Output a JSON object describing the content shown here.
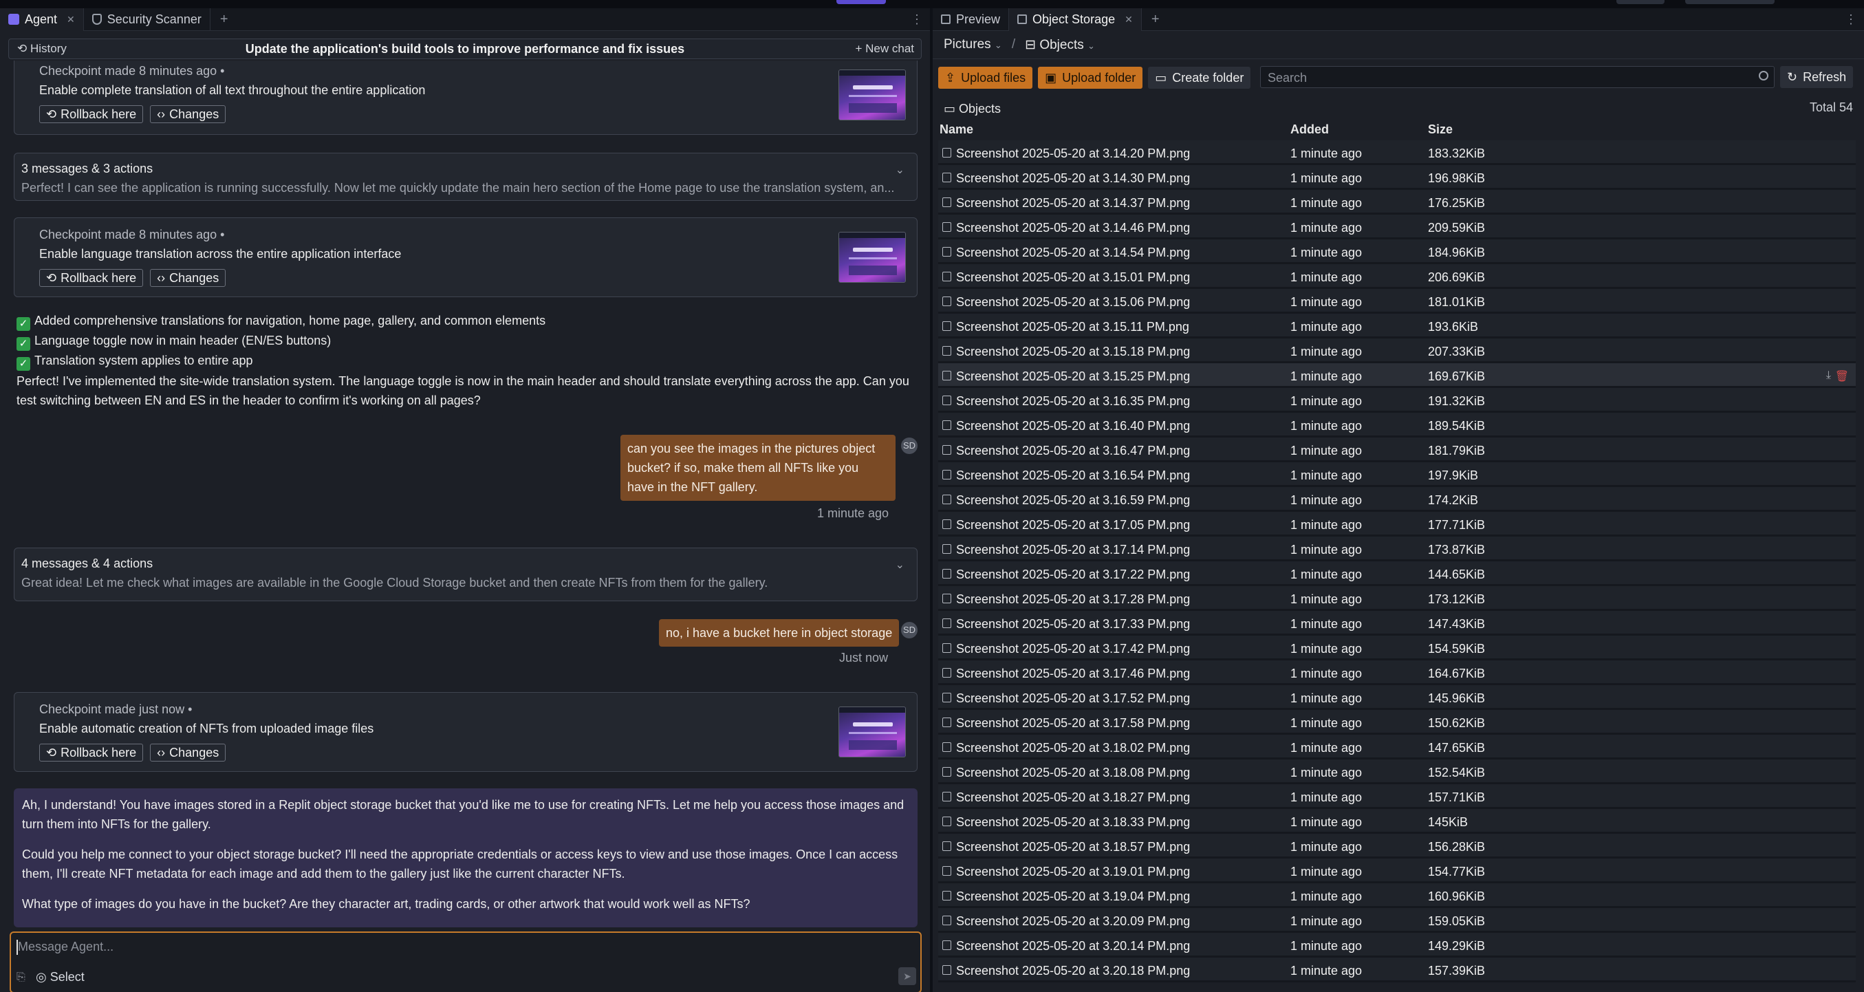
{
  "left_tabs": [
    {
      "label": "Agent"
    },
    {
      "label": "Security Scanner"
    }
  ],
  "chat_header": {
    "history_label": "History",
    "title": "Update the application's build tools to improve performance and fix issues",
    "new_chat_label": "+ New chat"
  },
  "checkpoints": [
    {
      "head": "Checkpoint made 8 minutes ago •",
      "text": "Enable complete translation of all text throughout the entire application",
      "rollback": "Rollback here",
      "changes": "Changes"
    },
    {
      "head": "Checkpoint made 8 minutes ago •",
      "text": "Enable language translation across the entire application interface",
      "rollback": "Rollback here",
      "changes": "Changes"
    },
    {
      "head": "Checkpoint made just now •",
      "text": "Enable automatic creation of NFTs from uploaded image files",
      "rollback": "Rollback here",
      "changes": "Changes"
    }
  ],
  "collapsed": [
    {
      "title": "3 messages & 3 actions",
      "summary": "Perfect! I can see the application is running successfully. Now let me quickly update the main hero section of the Home page to use the translation system, an..."
    },
    {
      "title": "4 messages & 4 actions",
      "summary": "Great idea! Let me check what images are available in the Google Cloud Storage bucket and then create NFTs from them for the gallery."
    }
  ],
  "checklist": [
    "Added comprehensive translations for navigation, home page, gallery, and common elements",
    "Language toggle now in main header (EN/ES buttons)",
    "Translation system applies to entire app"
  ],
  "agent_message_1": "Perfect! I've implemented the site-wide translation system. The language toggle is now in the main header and should translate everything across the app. Can you test switching between EN and ES in the header to confirm it's working on all pages?",
  "user_messages": [
    {
      "text": "can you see the images in the pictures object bucket? if so, make them all NFTs like you have in the NFT gallery.",
      "time": "1 minute ago",
      "avatar": "SD"
    },
    {
      "text": "no, i have a bucket here in object storage",
      "time": "Just now",
      "avatar": "SD"
    }
  ],
  "agent_reply": [
    "Ah, I understand! You have images stored in a Replit object storage bucket that you'd like me to use for creating NFTs. Let me help you access those images and turn them into NFTs for the gallery.",
    "Could you help me connect to your object storage bucket? I'll need the appropriate credentials or access keys to view and use those images. Once I can access them, I'll create NFT metadata for each image and add them to the gallery just like the current character NFTs.",
    "What type of images do you have in the bucket? Are they character art, trading cards, or other artwork that would work well as NFTs?"
  ],
  "composer": {
    "placeholder": "Message Agent...",
    "select_label": "Select"
  },
  "right_tabs": [
    {
      "label": "Preview"
    },
    {
      "label": "Object Storage"
    }
  ],
  "storage": {
    "bucket": "Pictures",
    "section": "Objects",
    "upload_files": "Upload files",
    "upload_folder": "Upload folder",
    "create_folder": "Create folder",
    "search_placeholder": "Search",
    "refresh": "Refresh",
    "objects_label": "Objects",
    "total": "Total 54",
    "columns": {
      "name": "Name",
      "added": "Added",
      "size": "Size"
    },
    "files": [
      {
        "name": "Screenshot 2025-05-20 at 3.14.20 PM.png",
        "added": "1 minute ago",
        "size": "183.32KiB"
      },
      {
        "name": "Screenshot 2025-05-20 at 3.14.30 PM.png",
        "added": "1 minute ago",
        "size": "196.98KiB"
      },
      {
        "name": "Screenshot 2025-05-20 at 3.14.37 PM.png",
        "added": "1 minute ago",
        "size": "176.25KiB"
      },
      {
        "name": "Screenshot 2025-05-20 at 3.14.46 PM.png",
        "added": "1 minute ago",
        "size": "209.59KiB"
      },
      {
        "name": "Screenshot 2025-05-20 at 3.14.54 PM.png",
        "added": "1 minute ago",
        "size": "184.96KiB"
      },
      {
        "name": "Screenshot 2025-05-20 at 3.15.01 PM.png",
        "added": "1 minute ago",
        "size": "206.69KiB"
      },
      {
        "name": "Screenshot 2025-05-20 at 3.15.06 PM.png",
        "added": "1 minute ago",
        "size": "181.01KiB"
      },
      {
        "name": "Screenshot 2025-05-20 at 3.15.11 PM.png",
        "added": "1 minute ago",
        "size": "193.6KiB"
      },
      {
        "name": "Screenshot 2025-05-20 at 3.15.18 PM.png",
        "added": "1 minute ago",
        "size": "207.33KiB"
      },
      {
        "name": "Screenshot 2025-05-20 at 3.15.25 PM.png",
        "added": "1 minute ago",
        "size": "169.67KiB"
      },
      {
        "name": "Screenshot 2025-05-20 at 3.16.35 PM.png",
        "added": "1 minute ago",
        "size": "191.32KiB"
      },
      {
        "name": "Screenshot 2025-05-20 at 3.16.40 PM.png",
        "added": "1 minute ago",
        "size": "189.54KiB"
      },
      {
        "name": "Screenshot 2025-05-20 at 3.16.47 PM.png",
        "added": "1 minute ago",
        "size": "181.79KiB"
      },
      {
        "name": "Screenshot 2025-05-20 at 3.16.54 PM.png",
        "added": "1 minute ago",
        "size": "197.9KiB"
      },
      {
        "name": "Screenshot 2025-05-20 at 3.16.59 PM.png",
        "added": "1 minute ago",
        "size": "174.2KiB"
      },
      {
        "name": "Screenshot 2025-05-20 at 3.17.05 PM.png",
        "added": "1 minute ago",
        "size": "177.71KiB"
      },
      {
        "name": "Screenshot 2025-05-20 at 3.17.14 PM.png",
        "added": "1 minute ago",
        "size": "173.87KiB"
      },
      {
        "name": "Screenshot 2025-05-20 at 3.17.22 PM.png",
        "added": "1 minute ago",
        "size": "144.65KiB"
      },
      {
        "name": "Screenshot 2025-05-20 at 3.17.28 PM.png",
        "added": "1 minute ago",
        "size": "173.12KiB"
      },
      {
        "name": "Screenshot 2025-05-20 at 3.17.33 PM.png",
        "added": "1 minute ago",
        "size": "147.43KiB"
      },
      {
        "name": "Screenshot 2025-05-20 at 3.17.42 PM.png",
        "added": "1 minute ago",
        "size": "154.59KiB"
      },
      {
        "name": "Screenshot 2025-05-20 at 3.17.46 PM.png",
        "added": "1 minute ago",
        "size": "164.67KiB"
      },
      {
        "name": "Screenshot 2025-05-20 at 3.17.52 PM.png",
        "added": "1 minute ago",
        "size": "145.96KiB"
      },
      {
        "name": "Screenshot 2025-05-20 at 3.17.58 PM.png",
        "added": "1 minute ago",
        "size": "150.62KiB"
      },
      {
        "name": "Screenshot 2025-05-20 at 3.18.02 PM.png",
        "added": "1 minute ago",
        "size": "147.65KiB"
      },
      {
        "name": "Screenshot 2025-05-20 at 3.18.08 PM.png",
        "added": "1 minute ago",
        "size": "152.54KiB"
      },
      {
        "name": "Screenshot 2025-05-20 at 3.18.27 PM.png",
        "added": "1 minute ago",
        "size": "157.71KiB"
      },
      {
        "name": "Screenshot 2025-05-20 at 3.18.33 PM.png",
        "added": "1 minute ago",
        "size": "145KiB"
      },
      {
        "name": "Screenshot 2025-05-20 at 3.18.57 PM.png",
        "added": "1 minute ago",
        "size": "156.28KiB"
      },
      {
        "name": "Screenshot 2025-05-20 at 3.19.01 PM.png",
        "added": "1 minute ago",
        "size": "154.77KiB"
      },
      {
        "name": "Screenshot 2025-05-20 at 3.19.04 PM.png",
        "added": "1 minute ago",
        "size": "160.96KiB"
      },
      {
        "name": "Screenshot 2025-05-20 at 3.20.09 PM.png",
        "added": "1 minute ago",
        "size": "159.05KiB"
      },
      {
        "name": "Screenshot 2025-05-20 at 3.20.14 PM.png",
        "added": "1 minute ago",
        "size": "149.29KiB"
      },
      {
        "name": "Screenshot 2025-05-20 at 3.20.18 PM.png",
        "added": "1 minute ago",
        "size": "157.39KiB"
      }
    ]
  },
  "colors": {
    "accent_orange": "#c87321",
    "user_bubble": "#7a4a25",
    "agent_box": "#332f4f"
  },
  "icons": [
    "agent-icon",
    "shield-icon",
    "history-icon",
    "preview-icon",
    "storage-icon",
    "folder-icon",
    "upload-icon",
    "search-icon",
    "refresh-icon",
    "file-image-icon",
    "download-icon",
    "trash-icon",
    "chevron-down-icon",
    "send-icon",
    "attach-icon"
  ]
}
